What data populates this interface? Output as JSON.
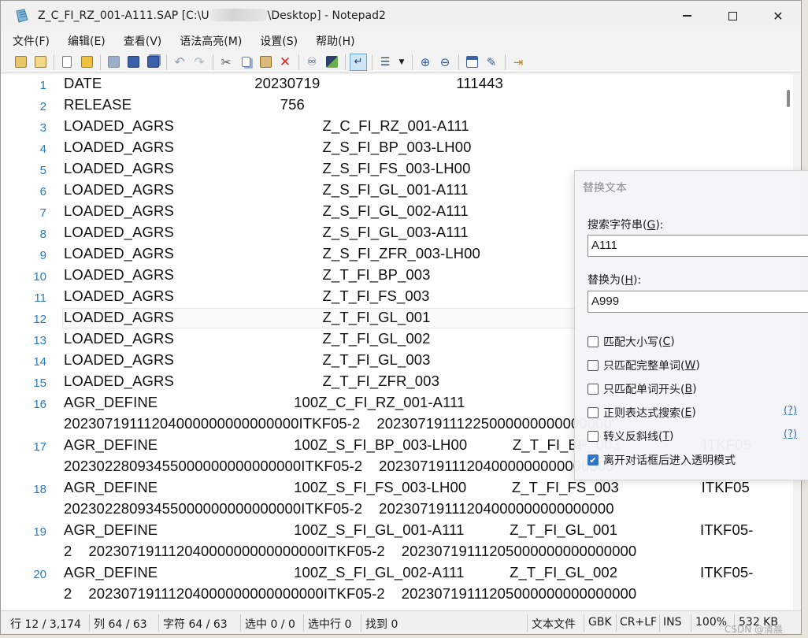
{
  "window": {
    "title_start": "Z_C_FI_RZ_001-A111.SAP [C:\\U",
    "title_end": "\\Desktop] - Notepad2",
    "minimize_glyph": "—",
    "close_glyph": "✕"
  },
  "menu": [
    "文件(F)",
    "编辑(E)",
    "查看(V)",
    "语法高亮(M)",
    "设置(S)",
    "帮助(H)"
  ],
  "toolbar_icons": [
    "new-window-icon",
    "find-in-files-icon",
    "new-file-icon",
    "open-folder-icon",
    "save-disabled-icon",
    "save-icon",
    "save-all-icon",
    "undo-icon",
    "redo-icon",
    "cut-icon",
    "copy-icon",
    "paste-icon",
    "delete-icon",
    "find-icon",
    "replace-icon",
    "word-wrap-icon",
    "list-icon",
    "zoom-in-icon",
    "zoom-out-icon",
    "schemes-icon",
    "customize-icon",
    "exit-icon"
  ],
  "editor": {
    "lines": [
      {
        "num": "1",
        "rows": [
          "DATE                                     20230719                                 111443"
        ]
      },
      {
        "num": "2",
        "rows": [
          "RELEASE                                    756"
        ]
      },
      {
        "num": "3",
        "rows": [
          "LOADED_AGRS                                    Z_C_FI_RZ_001-A111"
        ]
      },
      {
        "num": "4",
        "rows": [
          "LOADED_AGRS                                    Z_S_FI_BP_003-LH00"
        ]
      },
      {
        "num": "5",
        "rows": [
          "LOADED_AGRS                                    Z_S_FI_FS_003-LH00"
        ]
      },
      {
        "num": "6",
        "rows": [
          "LOADED_AGRS                                    Z_S_FI_GL_001-A111"
        ]
      },
      {
        "num": "7",
        "rows": [
          "LOADED_AGRS                                    Z_S_FI_GL_002-A111"
        ]
      },
      {
        "num": "8",
        "rows": [
          "LOADED_AGRS                                    Z_S_FI_GL_003-A111"
        ]
      },
      {
        "num": "9",
        "rows": [
          "LOADED_AGRS                                    Z_S_FI_ZFR_003-LH00"
        ]
      },
      {
        "num": "10",
        "rows": [
          "LOADED_AGRS                                    Z_T_FI_BP_003"
        ]
      },
      {
        "num": "11",
        "rows": [
          "LOADED_AGRS                                    Z_T_FI_FS_003"
        ]
      },
      {
        "num": "12",
        "rows": [
          "LOADED_AGRS                                    Z_T_FI_GL_001"
        ]
      },
      {
        "num": "13",
        "rows": [
          "LOADED_AGRS                                    Z_T_FI_GL_002"
        ]
      },
      {
        "num": "14",
        "rows": [
          "LOADED_AGRS                                    Z_T_FI_GL_003"
        ]
      },
      {
        "num": "15",
        "rows": [
          "LOADED_AGRS                                    Z_T_FI_ZFR_003"
        ]
      },
      {
        "num": "16",
        "rows": [
          "AGR_DEFINE                                 100Z_C_FI_RZ_001-A111",
          "20230719111204000000000000000ITKF05-2    20230719111225000000000000000"
        ]
      },
      {
        "num": "17",
        "rows": [
          "AGR_DEFINE                                 100Z_S_FI_BP_003-LH00           Z_T_FI_BP_003                    ITKF05",
          "20230228093455000000000000000ITKF05-2    20230719111204000000000000000"
        ]
      },
      {
        "num": "18",
        "rows": [
          "AGR_DEFINE                                 100Z_S_FI_FS_003-LH00           Z_T_FI_FS_003                    ITKF05",
          "20230228093455000000000000000ITKF05-2    20230719111204000000000000000"
        ]
      },
      {
        "num": "19",
        "rows": [
          "AGR_DEFINE                                 100Z_S_FI_GL_001-A111           Z_T_FI_GL_001                    ITKF05-",
          "2    20230719111204000000000000000ITKF05-2    20230719111205000000000000000"
        ]
      },
      {
        "num": "20",
        "rows": [
          "AGR_DEFINE                                 100Z_S_FI_GL_002-A111           Z_T_FI_GL_002                    ITKF05-",
          "2    20230719111204000000000000000ITKF05-2    20230719111205000000000000000"
        ]
      }
    ]
  },
  "status": {
    "line": "行 12 / 3,174",
    "col": "列 64 / 63",
    "char": "字符 64 / 63",
    "sel": "选中 0 / 0",
    "sel_lines": "选中行 0",
    "found": "找到 0",
    "filetype": "文本文件",
    "encoding": "GBK",
    "eol": "CR+LF",
    "ins": "INS",
    "zoom": "100%",
    "size": "532 KB"
  },
  "dialog": {
    "title": "替换文本",
    "search_label_pre": "搜索字符串(",
    "search_key": "G",
    "search_label_post": "):",
    "search_value": "A111",
    "replace_label_pre": "替换为(",
    "replace_key": "H",
    "replace_label_post": "):",
    "replace_value": "A999",
    "options": [
      {
        "pre": "匹配大小写(",
        "key": "C",
        "post": ")",
        "checked": false
      },
      {
        "pre": "只匹配完整单词(",
        "key": "W",
        "post": ")",
        "checked": false
      },
      {
        "pre": "只匹配单词开头(",
        "key": "B",
        "post": ")",
        "checked": false
      },
      {
        "pre": "正则表达式搜索(",
        "key": "E",
        "post": ")",
        "checked": false
      },
      {
        "pre": "转义反斜线(",
        "key": "T",
        "post": ")",
        "checked": false
      },
      {
        "pre": "离开对话框后进入透明模式",
        "key": "",
        "post": "",
        "checked": true
      }
    ],
    "help": "(?)"
  },
  "watermark": "CSDN @清晨"
}
